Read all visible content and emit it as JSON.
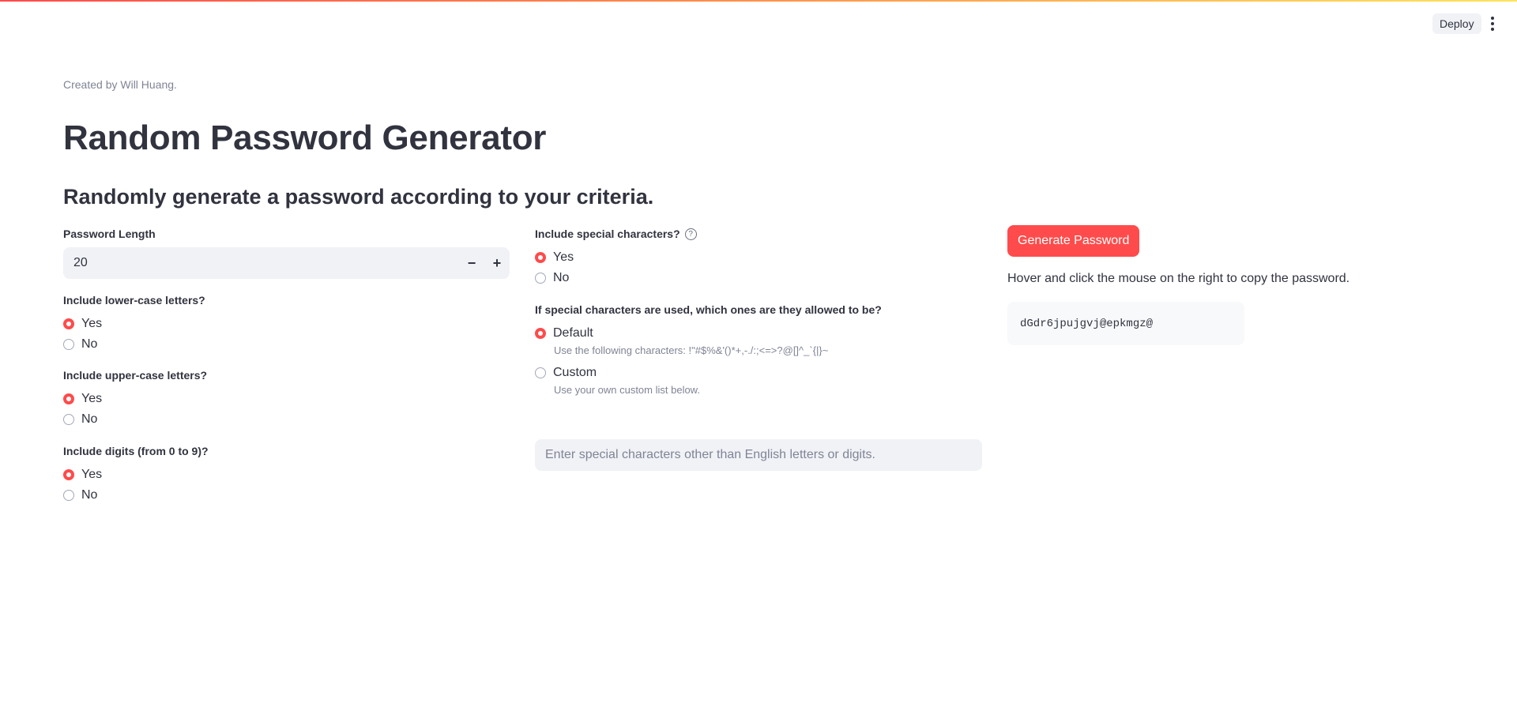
{
  "header": {
    "deploy_label": "Deploy"
  },
  "caption": "Created by Will Huang.",
  "title": "Random Password Generator",
  "subtitle": "Randomly generate a password according to your criteria.",
  "password_length": {
    "label": "Password Length",
    "value": "20",
    "decrement": "−",
    "increment": "+"
  },
  "lowercase": {
    "label": "Include lower-case letters?",
    "options": [
      "Yes",
      "No"
    ],
    "selected": "Yes"
  },
  "uppercase": {
    "label": "Include upper-case letters?",
    "options": [
      "Yes",
      "No"
    ],
    "selected": "Yes"
  },
  "digits": {
    "label": "Include digits (from 0 to 9)?",
    "options": [
      "Yes",
      "No"
    ],
    "selected": "Yes"
  },
  "special": {
    "label": "Include special characters?",
    "help_icon": "?",
    "options": [
      "Yes",
      "No"
    ],
    "selected": "Yes"
  },
  "special_set": {
    "label": "If special characters are used, which ones are they allowed to be?",
    "options": [
      {
        "label": "Default",
        "caption": "Use the following characters: !\"#$%&'()*+,-./:;<=>?@[]^_`{|}~"
      },
      {
        "label": "Custom",
        "caption": "Use your own custom list below."
      }
    ],
    "selected": "Default"
  },
  "custom_input": {
    "placeholder": "Enter special characters other than English letters or digits."
  },
  "generate": {
    "button_label": "Generate Password",
    "help": "Hover and click the mouse on the right to copy the password.",
    "password": "dGdr6jpujgvj@epkmgz@"
  },
  "colors": {
    "accent": "#ff4b4b",
    "input_bg": "#f0f2f6",
    "text": "#31333f",
    "muted": "#808495"
  }
}
